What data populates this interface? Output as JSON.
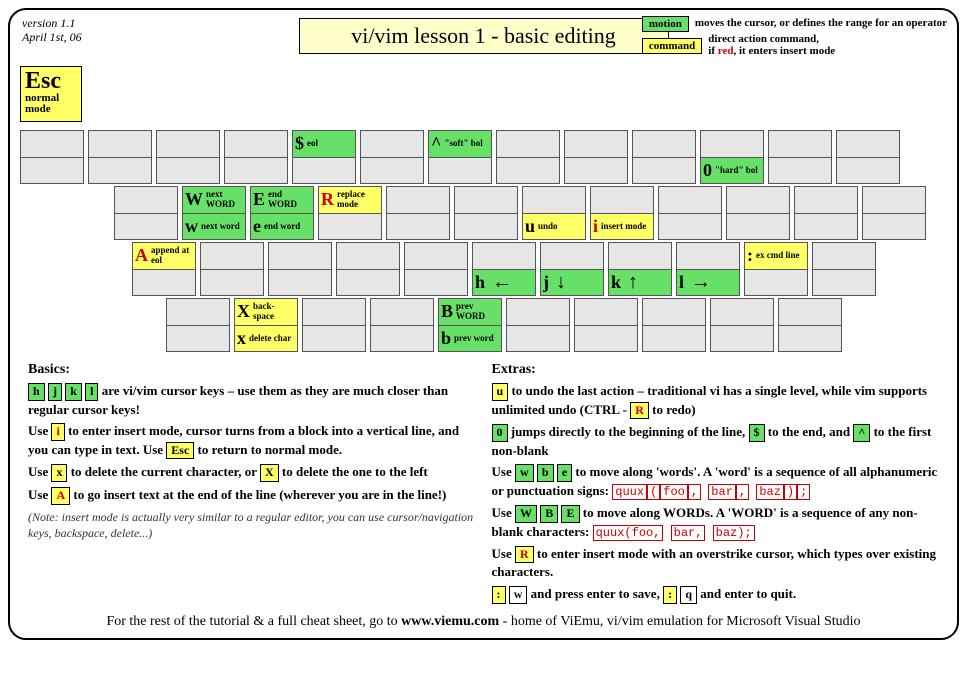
{
  "meta": {
    "version": "version 1.1",
    "date": "April 1st, 06"
  },
  "title": "vi/vim lesson 1 - basic editing",
  "legend": {
    "motion": {
      "label": "motion",
      "text": "moves the cursor, or defines the range for an operator"
    },
    "command": {
      "label": "command",
      "text_a": "direct action command,",
      "text_b": "if ",
      "text_red": "red",
      "text_c": ", it enters insert mode"
    }
  },
  "esc": {
    "big": "Esc",
    "small1": "normal",
    "small2": "mode"
  },
  "keys": {
    "dollar": {
      "g": "$",
      "l": "eol"
    },
    "caret": {
      "g": "^",
      "l": "\"soft\" bol"
    },
    "zero": {
      "g": "0",
      "l": "\"hard\" bol"
    },
    "W": {
      "g": "W",
      "l": "next WORD"
    },
    "w": {
      "g": "w",
      "l": "next word"
    },
    "E": {
      "g": "E",
      "l": "end WORD"
    },
    "e": {
      "g": "e",
      "l": "end word"
    },
    "R": {
      "g": "R",
      "l": "replace mode"
    },
    "u": {
      "g": "u",
      "l": "undo"
    },
    "i": {
      "g": "i",
      "l": "insert mode"
    },
    "A": {
      "g": "A",
      "l": "append at eol"
    },
    "h": {
      "g": "h",
      "a": "←"
    },
    "j": {
      "g": "j",
      "a": "↓"
    },
    "k": {
      "g": "k",
      "a": "↑"
    },
    "l": {
      "g": "l",
      "a": "→"
    },
    "colon": {
      "g": ":",
      "l": "ex cmd line"
    },
    "X": {
      "g": "X",
      "l": "back- space"
    },
    "x": {
      "g": "x",
      "l": "delete char"
    },
    "B": {
      "g": "B",
      "l": "prev WORD"
    },
    "b": {
      "g": "b",
      "l": "prev word"
    }
  },
  "basics": {
    "title": "Basics:",
    "p1a": " are vi/vim cursor keys – use them as they are  much closer than regular cursor keys!",
    "p2a": "Use ",
    "p2b": " to enter insert mode, cursor turns from a block into a vertical line, and you can type in text. Use ",
    "p2c": " to  return to normal mode.",
    "p3a": "Use ",
    "p3b": " to delete the current character, or ",
    "p3c": " to delete the one to the left",
    "p4a": "Use ",
    "p4b": " to go insert text at the end of the line (wherever you are in the line!)",
    "note": "(Note: insert mode is actually very similar to a regular editor, you can use cursor/navigation keys, backspace,  delete...)",
    "k": {
      "h": "h",
      "j": "j",
      "k": "k",
      "l": "l",
      "i": "i",
      "Esc": "Esc",
      "x": "x",
      "X": "X",
      "A": "A"
    }
  },
  "extras": {
    "title": "Extras:",
    "p1a": " to undo the last action – traditional vi has a single level, while vim supports unlimited undo (CTRL - ",
    "p1b": " to redo)",
    "p2a": " jumps directly to the beginning of the line, ",
    "p2b": " to the end, and ",
    "p2c": " to the first non-blank",
    "p3a": "Use ",
    "p3b": " to move along 'words'. A 'word' is a sequence of all alphanumeric or punctuation signs:  ",
    "p4a": "Use ",
    "p4b": " to move along WORDs. A 'WORD' is a sequence of any non-blank characters:   ",
    "p5a": " Use ",
    "p5b": " to enter insert mode with an overstrike cursor, which types over existing characters.",
    "p6a": " and press enter to save, ",
    "p6b": " and enter to quit.",
    "code1": {
      "a": "quux",
      "b": "(",
      "c": "foo",
      "d": ",",
      "e": "bar",
      "f": ",",
      "g": "baz",
      "h": ")",
      "i": ";"
    },
    "code2": {
      "a": "quux(foo,",
      "b": "bar,",
      "c": "baz);"
    },
    "k": {
      "u": "u",
      "R": "R",
      "0": "0",
      "dollar": "$",
      "caret": "^",
      "w": "w",
      "b": "b",
      "e": "e",
      "W": "W",
      "B": "B",
      "E": "E",
      "colon": ":",
      "wcmd": "w",
      "q": "q"
    }
  },
  "footer": {
    "a": "For the rest of the tutorial & a full cheat sheet, go to ",
    "b": "www.viemu.com",
    "c": " - home of ViEmu, vi/vim emulation for Microsoft Visual Studio"
  }
}
